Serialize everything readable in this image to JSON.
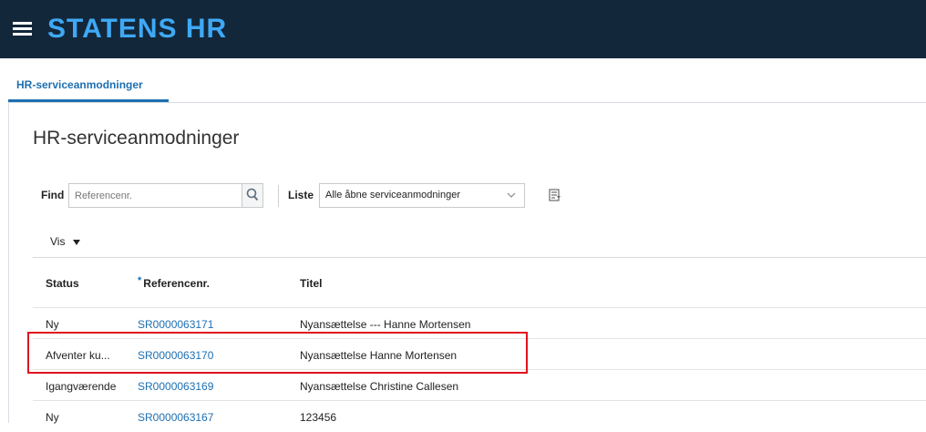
{
  "header": {
    "title": "STATENS HR"
  },
  "tabs": [
    {
      "label": "HR-serviceanmodninger"
    }
  ],
  "page": {
    "title": "HR-serviceanmodninger"
  },
  "filters": {
    "find_label": "Find",
    "find_placeholder": "Referencenr.",
    "list_label": "Liste",
    "list_value": "Alle åbne serviceanmodninger"
  },
  "view_menu": {
    "label": "Vis"
  },
  "table": {
    "columns": [
      {
        "label": "Status"
      },
      {
        "label": "Referencenr.",
        "required_marker": "*"
      },
      {
        "label": "Titel"
      }
    ],
    "rows": [
      {
        "status": "Ny",
        "reference": "SR0000063171",
        "title": "Nyansættelse --- Hanne Mortensen"
      },
      {
        "status": "Afventer ku...",
        "reference": "SR0000063170",
        "title": "Nyansættelse Hanne Mortensen"
      },
      {
        "status": "Igangværende",
        "reference": "SR0000063169",
        "title": "Nyansættelse Christine Callesen"
      },
      {
        "status": "Ny",
        "reference": "SR0000063167",
        "title": "123456"
      }
    ]
  },
  "annotation": {
    "highlight_color": "#e0121f",
    "highlighted_row": 2
  },
  "colors": {
    "header_bg": "#13273b",
    "brand": "#3fa9f5",
    "link": "#1d6fb1"
  },
  "icons": {
    "menu": "hamburger-menu-icon",
    "search": "search-icon",
    "list_dropdown": "chevron-down-icon",
    "report": "report-icon",
    "vis_menu": "caret-down-icon"
  }
}
